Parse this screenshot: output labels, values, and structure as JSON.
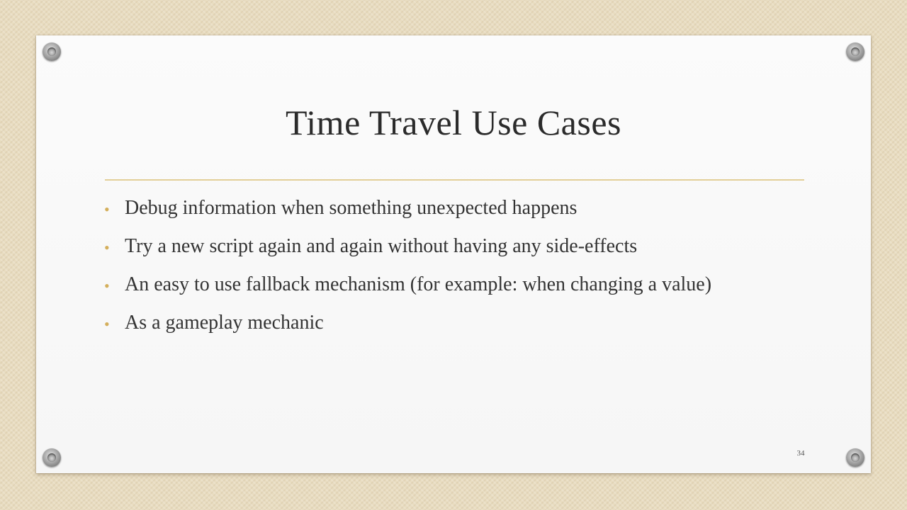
{
  "slide": {
    "title": "Time Travel Use Cases",
    "bullets": [
      "Debug information when something unexpected happens",
      "Try a new script again and again without having any side-effects",
      "An easy to use fallback mechanism (for example: when changing a value)",
      "As a gameplay mechanic"
    ],
    "bullet_glyph": "•",
    "slide_number": "34"
  },
  "colors": {
    "background": "#e8dcc0",
    "panel": "#f9f9f9",
    "accent": "#d4af5c",
    "divider": "#e3cf98",
    "text": "#333333"
  }
}
